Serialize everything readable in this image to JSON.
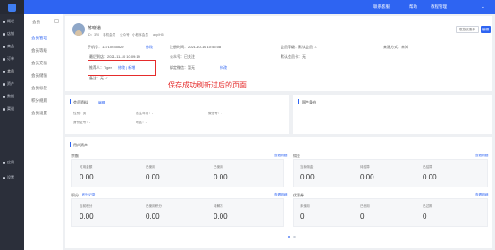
{
  "app": {
    "brand_color": "#2e64f2",
    "sidebar_color": "#2b2f3a"
  },
  "sidebar": {
    "items": [
      {
        "label": "概况"
      },
      {
        "label": "店铺"
      },
      {
        "label": "商品"
      },
      {
        "label": "订单"
      },
      {
        "label": "会员"
      },
      {
        "label": "资产"
      },
      {
        "label": "数据"
      },
      {
        "label": "渠道"
      },
      {
        "label": "应用"
      },
      {
        "label": "设置"
      }
    ]
  },
  "topbar": {
    "contact": "联系客服",
    "help": "帮助",
    "account": "教程管理"
  },
  "subnav": {
    "title": "会员",
    "items": [
      "会员管理",
      "会员等级",
      "会员充值",
      "会员储值",
      "会员标签",
      "积分规则",
      "会员设置"
    ]
  },
  "profile": {
    "name": "苏晓道",
    "stats": [
      "ID：370",
      "手机会员",
      "公众号",
      "小程序会员",
      "app/H5"
    ],
    "phone": "手机号：13710035529",
    "phone_edit": "修改",
    "birthday": "最后到店：2021-11-10 10:09:19",
    "referrer_label": "推荐人：Tiger",
    "referrer_edit": "修改 | 新增",
    "note": "备注：无 ∠",
    "register": "注册时间：2021-10-16 10:55:08",
    "official": "公众号：已关注",
    "expire": "绑定微信：暂无",
    "level": "会员等级：默认会员 ∠",
    "card": "默认会员卡：无",
    "source": "来源方式：未知",
    "send_coupon": "发放优惠券",
    "edit": "编辑"
  },
  "annotation": "保存成功刷新过后的页面",
  "info": {
    "title": "会员资料",
    "edit": "编辑",
    "gender": "性别：男",
    "birthday": "出生年月：-",
    "wechat": "微信号：-",
    "id_card": "身份证号：-",
    "region": "地区：-",
    "tags_title": "国产身份"
  },
  "assets": {
    "title": "用户资产",
    "balance": {
      "title": "余额",
      "link": "查看明细",
      "cols": [
        {
          "label": "可用金额",
          "value": "0.00"
        },
        {
          "label": "已使用",
          "value": "0.00"
        },
        {
          "label": "已使用",
          "value": "0.00"
        }
      ]
    },
    "commission": {
      "title": "佣金",
      "link": "查看明细",
      "cols": [
        {
          "label": "当前佣金",
          "value": "0.00"
        },
        {
          "label": "待结算",
          "value": "0.00"
        },
        {
          "label": "已结算",
          "value": "0.00"
        }
      ]
    },
    "points": {
      "title": "积分",
      "link": "查看明细",
      "sub": "积分记录",
      "cols": [
        {
          "label": "当前积分",
          "value": "0.00"
        },
        {
          "label": "已使用积分",
          "value": "0.00"
        },
        {
          "label": "待解冻",
          "value": "0.00"
        }
      ]
    },
    "coupons": {
      "title": "优惠券",
      "link": "查看明细",
      "cols": [
        {
          "label": "未使用",
          "value": "0"
        },
        {
          "label": "已使用",
          "value": "0"
        },
        {
          "label": "已过期",
          "value": "0"
        }
      ]
    }
  }
}
